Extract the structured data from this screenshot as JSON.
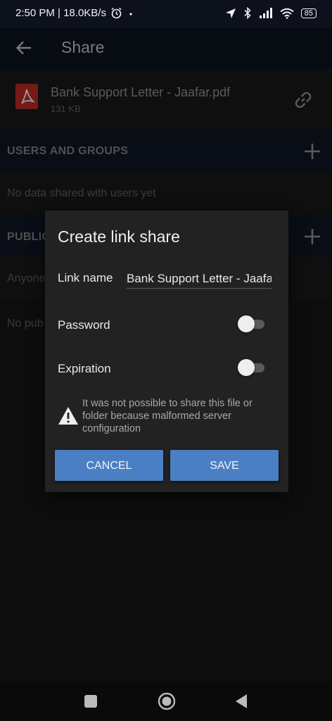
{
  "status_bar": {
    "time_speed": "2:50 PM | 18.0KB/s",
    "battery": "85"
  },
  "app_bar": {
    "title": "Share"
  },
  "file": {
    "name": "Bank Support Letter - Jaafar.pdf",
    "size": "131 KB"
  },
  "sections": {
    "users": {
      "title": "USERS AND GROUPS",
      "empty": "No data shared with users yet"
    },
    "public": {
      "title_visible": "PUBLIC",
      "subtitle_visible": "Anyone",
      "empty_visible": "No pub"
    }
  },
  "dialog": {
    "title": "Create link share",
    "link_name_label": "Link name",
    "link_name_value": "Bank Support Letter - Jaafar.pdf",
    "password_label": "Password",
    "password_enabled": false,
    "expiration_label": "Expiration",
    "expiration_enabled": false,
    "warning": "It was not possible to share this file or folder because malformed server configuration",
    "cancel_label": "CANCEL",
    "save_label": "SAVE"
  },
  "colors": {
    "accent": "#4a7fc4",
    "pdf_red": "#b22a26"
  }
}
